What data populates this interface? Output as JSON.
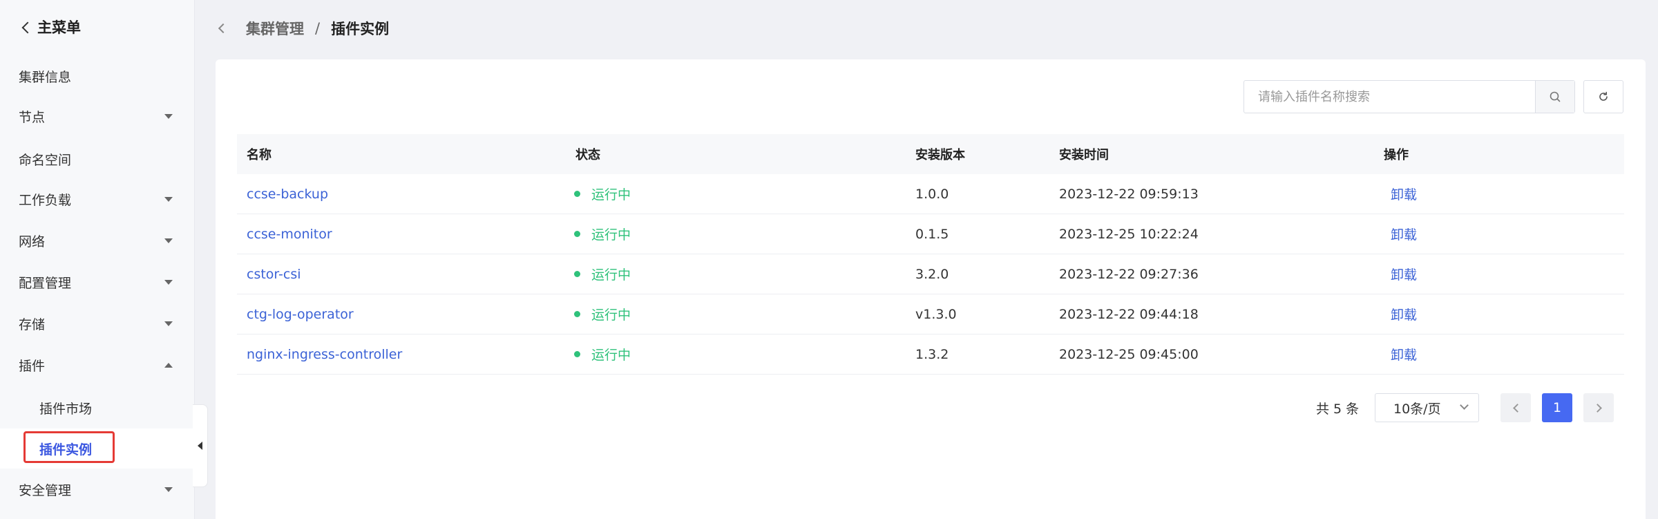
{
  "sidebar": {
    "title": "主菜单",
    "items": [
      {
        "label": "集群信息"
      },
      {
        "label": "节点"
      },
      {
        "label": "命名空间"
      },
      {
        "label": "工作负载"
      },
      {
        "label": "网络"
      },
      {
        "label": "配置管理"
      },
      {
        "label": "存储"
      },
      {
        "label": "插件"
      },
      {
        "label": "插件市场"
      },
      {
        "label": "插件实例"
      },
      {
        "label": "安全管理"
      }
    ]
  },
  "breadcrumb": {
    "parent": "集群管理",
    "separator": "/",
    "current": "插件实例"
  },
  "search": {
    "placeholder": "请输入插件名称搜索"
  },
  "table": {
    "headers": [
      "名称",
      "状态",
      "安装版本",
      "安装时间",
      "操作"
    ],
    "rows": [
      {
        "name": "ccse-backup",
        "status": "运行中",
        "version": "1.0.0",
        "time": "2023-12-22 09:59:13",
        "action": "卸载"
      },
      {
        "name": "ccse-monitor",
        "status": "运行中",
        "version": "0.1.5",
        "time": "2023-12-25 10:22:24",
        "action": "卸载"
      },
      {
        "name": "cstor-csi",
        "status": "运行中",
        "version": "3.2.0",
        "time": "2023-12-22 09:27:36",
        "action": "卸载"
      },
      {
        "name": "ctg-log-operator",
        "status": "运行中",
        "version": "v1.3.0",
        "time": "2023-12-22 09:44:18",
        "action": "卸载"
      },
      {
        "name": "nginx-ingress-controller",
        "status": "运行中",
        "version": "1.3.2",
        "time": "2023-12-25 09:45:00",
        "action": "卸载"
      }
    ]
  },
  "pagination": {
    "total": "共 5 条",
    "page_size": "10条/页",
    "current_page": "1"
  },
  "colors": {
    "accent": "#4669f2",
    "link": "#3b62d6",
    "running": "#2fc27b",
    "highlight": "#e53a35"
  }
}
